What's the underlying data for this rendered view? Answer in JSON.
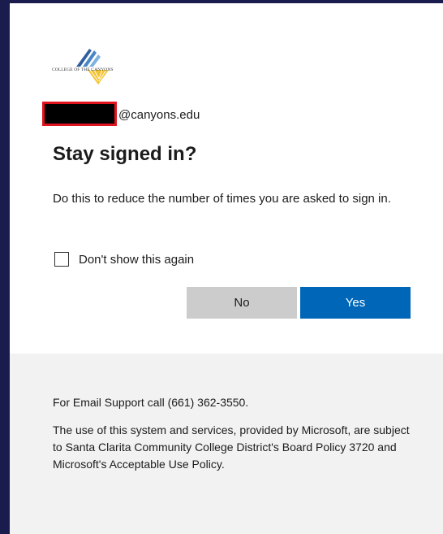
{
  "logo": {
    "text": "COLLEGE OF THE CANYONS"
  },
  "identity": {
    "domain": "@canyons.edu"
  },
  "title": "Stay signed in?",
  "description": "Do this to reduce the number of times you are asked to sign in.",
  "checkbox": {
    "label": "Don't show this again",
    "checked": false
  },
  "buttons": {
    "no": "No",
    "yes": "Yes"
  },
  "footer": {
    "support": "For Email Support call (661) 362-3550.",
    "policy": "The use of this system and services, provided by Microsoft, are subject to Santa Clarita Community College District's Board Policy 3720 and Microsoft's Acceptable Use Policy."
  },
  "colors": {
    "background": "#1b1c4e",
    "primary_button": "#0067b8",
    "secondary_button": "#cccccc",
    "footer_bg": "#f2f2f2",
    "redaction_border": "#e0141e"
  }
}
